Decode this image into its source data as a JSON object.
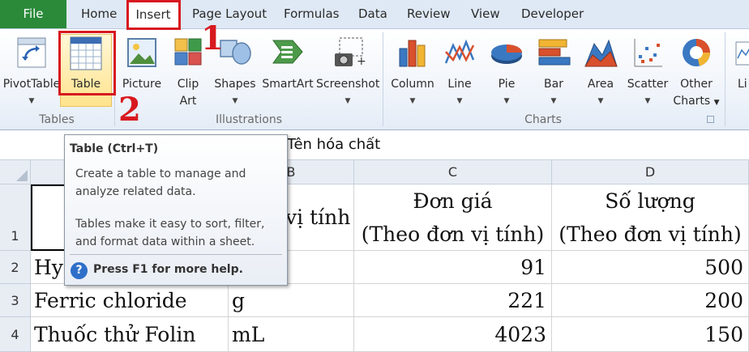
{
  "ribbon_tabs": {
    "file": "File",
    "home": "Home",
    "insert": "Insert",
    "page_layout": "Page Layout",
    "formulas": "Formulas",
    "data": "Data",
    "review": "Review",
    "view": "View",
    "developer": "Developer"
  },
  "groups": {
    "tables": {
      "label": "Tables",
      "pivot_table": "PivotTable",
      "table": "Table"
    },
    "illustrations": {
      "label": "Illustrations",
      "picture": "Picture",
      "clip_art_line1": "Clip",
      "clip_art_line2": "Art",
      "shapes": "Shapes",
      "smartart": "SmartArt",
      "screenshot": "Screenshot"
    },
    "charts": {
      "label": "Charts",
      "column": "Column",
      "line": "Line",
      "pie": "Pie",
      "bar": "Bar",
      "area": "Area",
      "scatter": "Scatter",
      "other_line1": "Other",
      "other_line2": "Charts",
      "partial_next": "Li"
    }
  },
  "annotations": {
    "step1": "1",
    "step2": "2"
  },
  "formula_bar": {
    "content": "Tên hóa chất"
  },
  "tooltip": {
    "title": "Table (Ctrl+T)",
    "line1": "Create a table to manage and",
    "line2": "analyze related data.",
    "line3": "Tables make it easy to sort, filter,",
    "line4": "and format data within a sheet.",
    "help": "Press F1 for more help.",
    "help_icon": "?"
  },
  "columns": [
    "B",
    "C",
    "D"
  ],
  "rows": [
    {
      "num": "1",
      "b": "vị tính",
      "c_line1": "Đơn giá",
      "c_line2": "(Theo đơn vị tính)",
      "d_line1": "Số lượng",
      "d_line2": "(Theo đơn vị tính)"
    },
    {
      "num": "2",
      "a": "Hy",
      "b": "",
      "c": "91",
      "d": "500"
    },
    {
      "num": "3",
      "a": "Ferric chloride",
      "b": "g",
      "c": "221",
      "d": "200"
    },
    {
      "num": "4",
      "a": "Thuốc thử Folin",
      "b": "mL",
      "c": "4023",
      "d": "150"
    }
  ],
  "colors": {
    "file_tab": "#2a8a3a",
    "annotation_red": "#d7191f",
    "help_icon": "#2f6fc9"
  }
}
